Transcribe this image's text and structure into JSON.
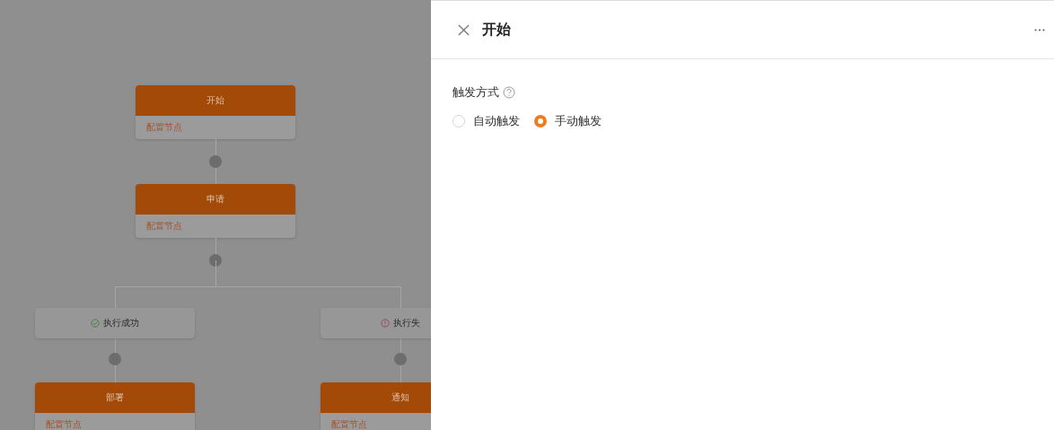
{
  "flow": {
    "steps": [
      {
        "title": "开始",
        "subtitle": "配置节点"
      },
      {
        "title": "申请",
        "subtitle": "配置节点"
      }
    ],
    "branches": [
      {
        "condition": {
          "label": "执行成功",
          "kind": "success"
        },
        "node": {
          "title": "部署",
          "subtitle": "配置节点"
        }
      },
      {
        "condition": {
          "label": "执行失",
          "kind": "failure"
        },
        "node": {
          "title": "通知",
          "subtitle": "配置节点"
        }
      }
    ]
  },
  "drawer": {
    "title": "开始",
    "field": {
      "label": "触发方式",
      "options": [
        {
          "label": "自动触发",
          "selected": false
        },
        {
          "label": "手动触发",
          "selected": true
        }
      ]
    }
  }
}
